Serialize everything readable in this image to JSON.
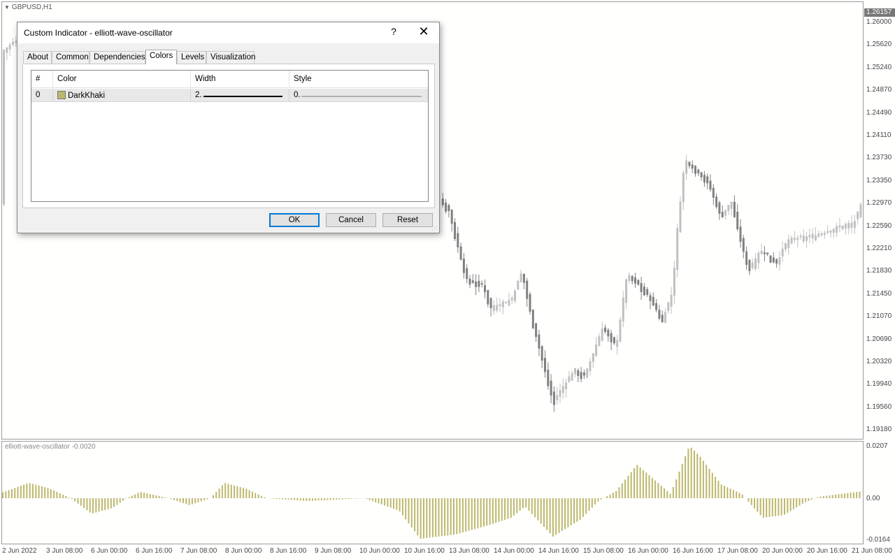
{
  "chart": {
    "symbol_title": "GBPUSD,H1",
    "current_price": "1.26157",
    "price_axis": [
      "1.26000",
      "1.25620",
      "1.25240",
      "1.24870",
      "1.24490",
      "1.24110",
      "1.23730",
      "1.23350",
      "1.22970",
      "1.22590",
      "1.22210",
      "1.21830",
      "1.21450",
      "1.21070",
      "1.20690",
      "1.20320",
      "1.19940",
      "1.19560",
      "1.19180"
    ],
    "time_axis": [
      "2 Jun 2022",
      "3 Jun 08:00",
      "6 Jun 00:00",
      "6 Jun 16:00",
      "7 Jun 08:00",
      "8 Jun 00:00",
      "8 Jun 16:00",
      "9 Jun 08:00",
      "10 Jun 00:00",
      "10 Jun 16:00",
      "13 Jun 08:00",
      "14 Jun 00:00",
      "14 Jun 16:00",
      "15 Jun 08:00",
      "16 Jun 00:00",
      "16 Jun 16:00",
      "17 Jun 08:00",
      "20 Jun 00:00",
      "20 Jun 16:00",
      "21 Jun 08:00"
    ],
    "colors": {
      "bull": "#c0c0c0",
      "bear": "#808080",
      "oscillator": "#bdb76b"
    }
  },
  "oscillator": {
    "title": "elliott-wave-oscillator -0.0020",
    "axis": [
      "0.0207",
      "0.00",
      "-0.0164"
    ]
  },
  "dialog": {
    "title": "Custom Indicator - elliott-wave-oscillator",
    "help_label": "?",
    "close_label": "✕",
    "tabs": [
      "About",
      "Common",
      "Dependencies",
      "Colors",
      "Levels",
      "Visualization"
    ],
    "active_tab": "Colors",
    "table": {
      "headers": [
        "#",
        "Color",
        "Width",
        "Style"
      ],
      "rows": [
        {
          "index": "0",
          "color_name": "DarkKhaki",
          "color_hex": "#bdb76b",
          "width": "2.",
          "style": "0."
        }
      ]
    },
    "buttons": {
      "ok": "OK",
      "cancel": "Cancel",
      "reset": "Reset"
    }
  }
}
